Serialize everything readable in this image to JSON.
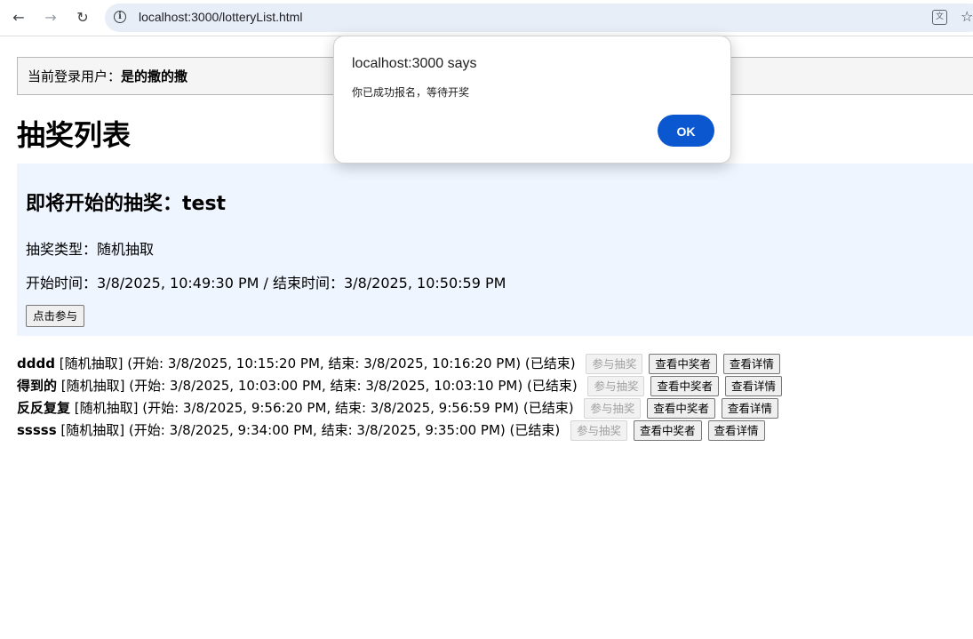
{
  "browser": {
    "url": "localhost:3000/lotteryList.html",
    "icons": [
      "back-icon",
      "forward-icon",
      "reload-icon",
      "info-icon",
      "translate-icon",
      "bookmark-star-icon"
    ]
  },
  "user_bar": {
    "label": "当前登录用户：",
    "username": "是的撒的撒"
  },
  "page_title": "抽奖列表",
  "upcoming": {
    "title": "即将开始的抽奖：test",
    "type": "抽奖类型：随机抽取",
    "time": "开始时间：3/8/2025, 10:49:30 PM / 结束时间：3/8/2025, 10:50:59 PM",
    "join_label": "点击参与"
  },
  "lotteries": [
    {
      "name": "dddd",
      "info": " [随机抽取] (开始: 3/8/2025, 10:15:20 PM, 结束: 3/8/2025, 10:16:20 PM) (已结束)",
      "join": "参与抽奖",
      "winners": "查看中奖者",
      "details": "查看详情"
    },
    {
      "name": "得到的",
      "info": " [随机抽取] (开始: 3/8/2025, 10:03:00 PM, 结束: 3/8/2025, 10:03:10 PM) (已结束)",
      "join": "参与抽奖",
      "winners": "查看中奖者",
      "details": "查看详情"
    },
    {
      "name": "反反复复",
      "info": " [随机抽取] (开始: 3/8/2025, 9:56:20 PM, 结束: 3/8/2025, 9:56:59 PM) (已结束)",
      "join": "参与抽奖",
      "winners": "查看中奖者",
      "details": "查看详情"
    },
    {
      "name": "sssss",
      "info": " [随机抽取] (开始: 3/8/2025, 9:34:00 PM, 结束: 3/8/2025, 9:35:00 PM) (已结束)",
      "join": "参与抽奖",
      "winners": "查看中奖者",
      "details": "查看详情"
    }
  ],
  "dialog": {
    "title": "localhost:3000 says",
    "message": "你已成功报名，等待开奖",
    "ok_label": "OK"
  },
  "colors": {
    "dialog_button": "#0b57d0",
    "upcoming_bg": "#eef5ff",
    "omnibox_bg": "#e8eef8"
  }
}
